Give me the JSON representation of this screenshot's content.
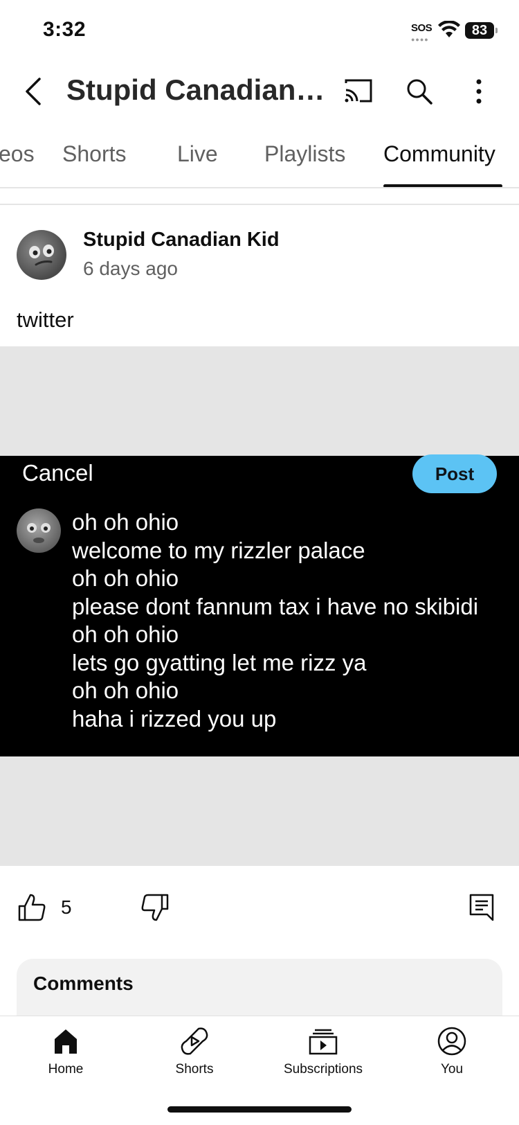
{
  "status_bar": {
    "time": "3:32",
    "sos": "SOS",
    "battery": "83"
  },
  "header": {
    "channel_title": "Stupid Canadian Kid",
    "icons": [
      "back-icon",
      "cast-icon",
      "search-icon",
      "more-vert-icon"
    ]
  },
  "tabs": {
    "items": [
      {
        "label": "Videos"
      },
      {
        "label": "Shorts"
      },
      {
        "label": "Live"
      },
      {
        "label": "Playlists"
      },
      {
        "label": "Community"
      }
    ],
    "visible_first_fragment": "eos",
    "active": "Community"
  },
  "post": {
    "author": "Stupid Canadian Kid",
    "time_ago": "6 days ago",
    "text": "twitter",
    "image": {
      "cancel_label": "Cancel",
      "post_label": "Post",
      "post_button_color": "#5cc3f4",
      "lines": [
        "oh oh ohio",
        "welcome to my rizzler palace",
        "oh oh ohio",
        "please dont fannum tax i have no skibidi",
        "oh oh ohio",
        "lets go gyatting let me rizz ya",
        "oh oh ohio",
        "haha i rizzed you up"
      ]
    },
    "likes": "5"
  },
  "comments": {
    "title": "Comments"
  },
  "bottom_nav": {
    "items": [
      {
        "label": "Home",
        "icon": "home-icon"
      },
      {
        "label": "Shorts",
        "icon": "shorts-icon"
      },
      {
        "label": "Subscriptions",
        "icon": "subscriptions-icon"
      },
      {
        "label": "You",
        "icon": "account-icon"
      }
    ],
    "active": "Home"
  }
}
